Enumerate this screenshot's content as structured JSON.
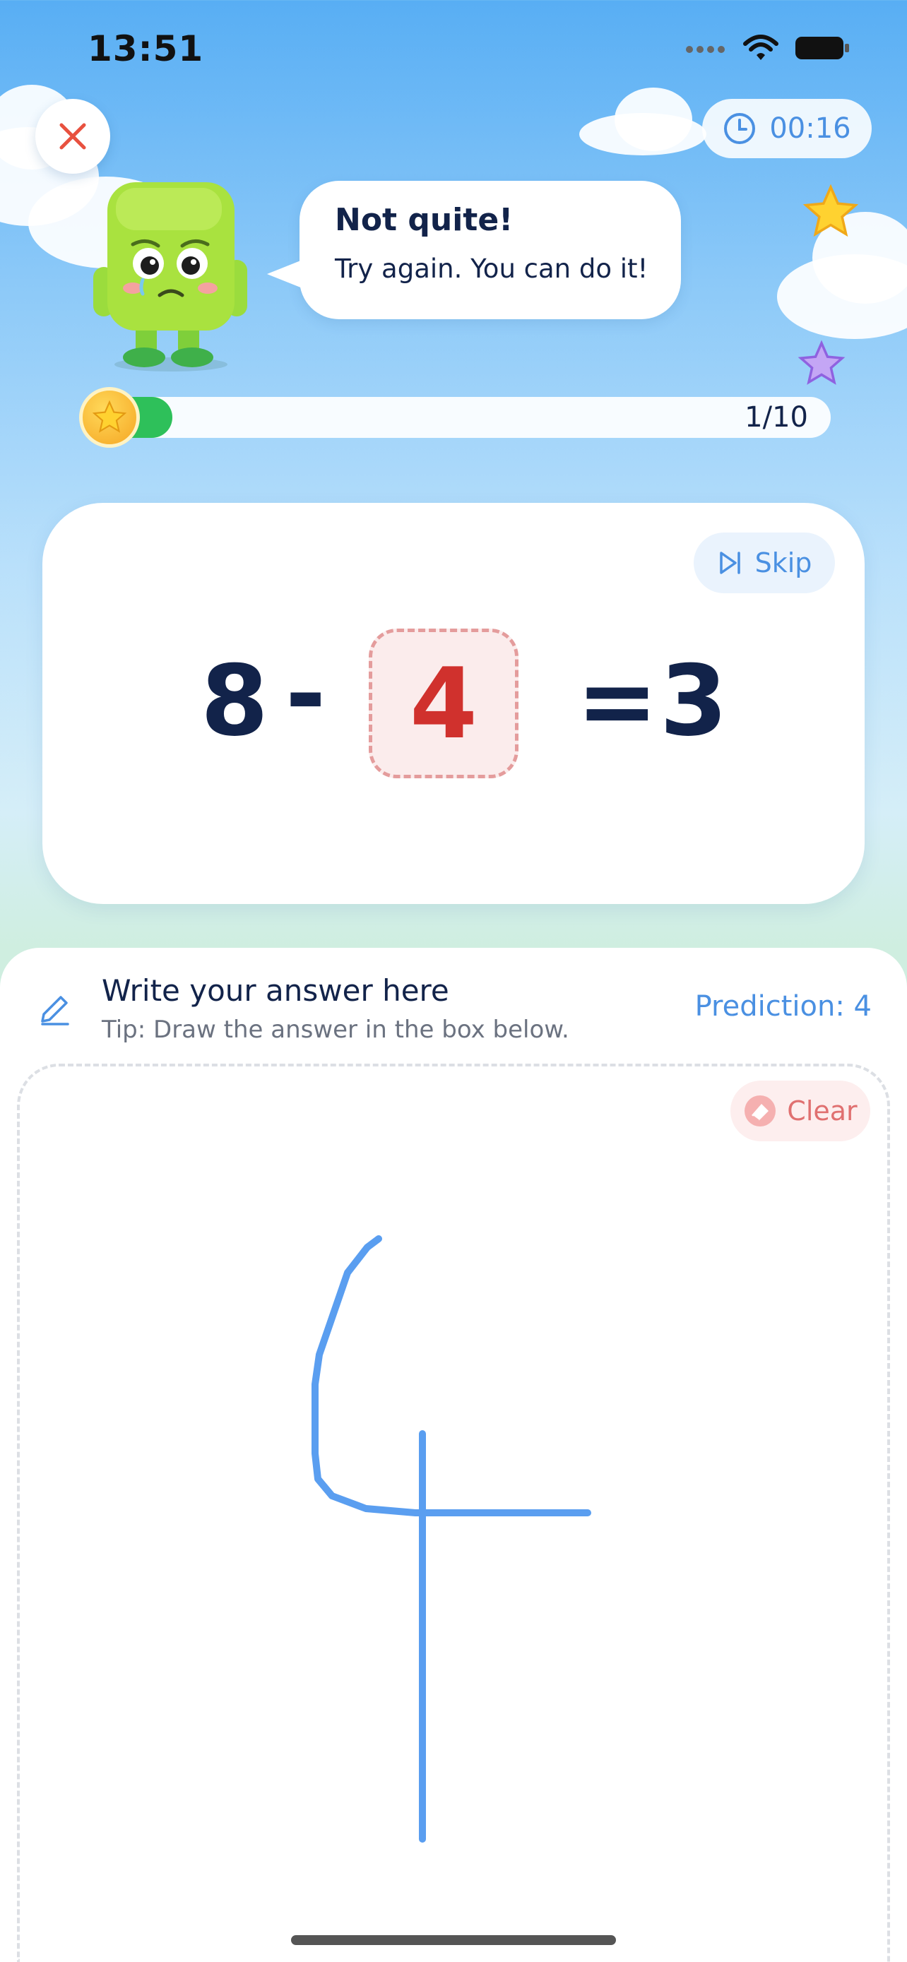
{
  "status_bar": {
    "time": "13:51"
  },
  "header": {
    "timer": "00:16"
  },
  "mascot": {
    "title": "Not quite!",
    "message": "Try again. You can do it!"
  },
  "progress": {
    "label": "1/10",
    "fraction": 0.1,
    "fill_color": "#2ec05a"
  },
  "question": {
    "skip_label": "Skip",
    "operand_a": "8",
    "operator": "-",
    "answer": "4",
    "equals": "=",
    "result": "3"
  },
  "writing": {
    "title": "Write your answer here",
    "tip": "Tip: Draw the answer in the box below.",
    "prediction": "Prediction: 4",
    "clear_label": "Clear",
    "stroke_color": "#5a9ef0"
  },
  "colors": {
    "accent": "#4a90e2",
    "text_dark": "#12234a",
    "error_red": "#d0312d",
    "star_yellow": "#f5c518"
  },
  "icons": [
    "close-icon",
    "clock-icon",
    "star-icon",
    "skip-icon",
    "pencil-icon",
    "eraser-icon",
    "wifi-icon",
    "battery-icon",
    "signal-icon"
  ]
}
